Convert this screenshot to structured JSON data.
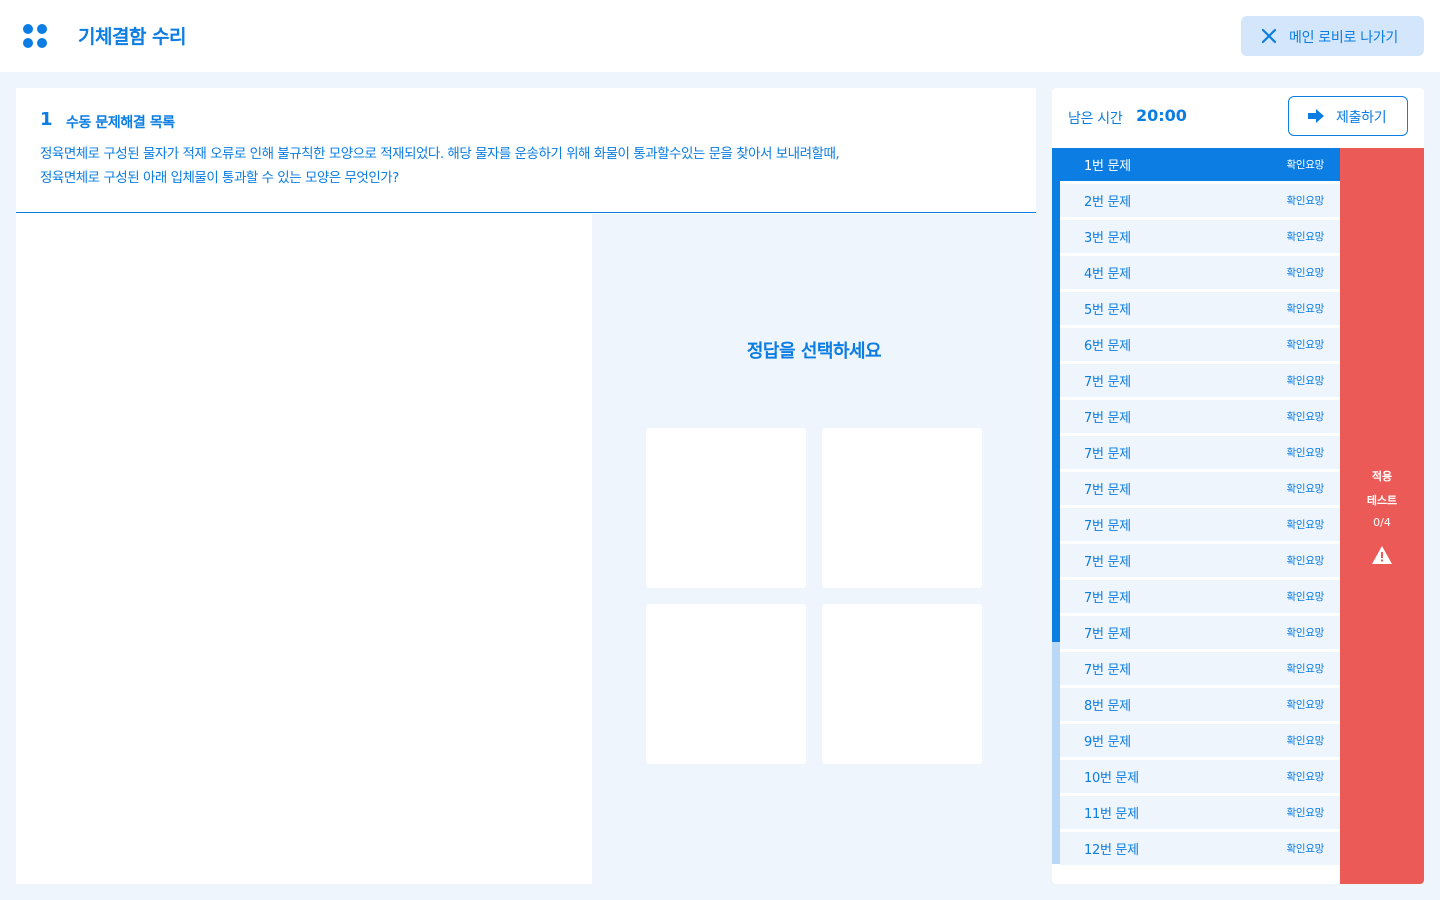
{
  "header": {
    "app_icon": "apps-grid-icon",
    "title": "기체결함 수리",
    "exit_button": {
      "icon": "close-icon",
      "label": "메인 로비로 나가기"
    }
  },
  "question": {
    "number": "1",
    "title": "수동 문제해결 목록",
    "body_line1": "정육면체로 구성된 물자가 적재 오류로 인해 불규칙한 모양으로 적재되었다. 해당 물자를 운송하기 위해 화물이 통과할수있는 문을 찾아서 보내려할때,",
    "body_line2": "정육면체로 구성된 아래 입체물이 통과할 수 있는 모양은 무엇인가?",
    "select_title": "정답을 선택하세요",
    "choices": 4
  },
  "sidebar": {
    "timer_label": "남은 시간",
    "timer_value": "20:00",
    "submit_button": {
      "icon": "arrow-right-icon",
      "label": "제출하기"
    },
    "progress_fraction": 0.69,
    "items": [
      {
        "label": "1번 문제",
        "status": "확인요망",
        "active": true
      },
      {
        "label": "2번 문제",
        "status": "확인요망"
      },
      {
        "label": "3번 문제",
        "status": "확인요망"
      },
      {
        "label": "4번 문제",
        "status": "확인요망"
      },
      {
        "label": "5번 문제",
        "status": "확인요망"
      },
      {
        "label": "6번 문제",
        "status": "확인요망"
      },
      {
        "label": "7번 문제",
        "status": "확인요망"
      },
      {
        "label": "7번 문제",
        "status": "확인요망"
      },
      {
        "label": "7번 문제",
        "status": "확인요망"
      },
      {
        "label": "7번 문제",
        "status": "확인요망"
      },
      {
        "label": "7번 문제",
        "status": "확인요망"
      },
      {
        "label": "7번 문제",
        "status": "확인요망"
      },
      {
        "label": "7번 문제",
        "status": "확인요망"
      },
      {
        "label": "7번 문제",
        "status": "확인요망"
      },
      {
        "label": "7번 문제",
        "status": "확인요망"
      },
      {
        "label": "8번 문제",
        "status": "확인요망"
      },
      {
        "label": "9번 문제",
        "status": "확인요망"
      },
      {
        "label": "10번 문제",
        "status": "확인요망"
      },
      {
        "label": "11번 문제",
        "status": "확인요망"
      },
      {
        "label": "12번 문제",
        "status": "확인요망"
      }
    ],
    "apply_test": {
      "line1": "적용",
      "line2": "테스트",
      "count": "0/4",
      "icon": "warning-icon"
    }
  },
  "colors": {
    "primary": "#0b7de3",
    "background": "#eef5fd",
    "exit_button_bg": "#d3e6fb",
    "apply_test_bg": "#ec5a57",
    "progress_track": "#b9d8f8"
  }
}
